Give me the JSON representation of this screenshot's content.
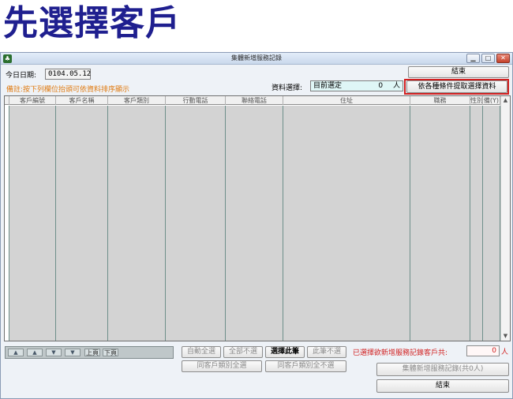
{
  "heading": "先選擇客戶",
  "window": {
    "title": "集體新增服務記錄",
    "app_icon": "app-icon",
    "controls": [
      "minimize",
      "maximize",
      "close"
    ]
  },
  "today": {
    "label": "今日日期:",
    "value": "0104.05.12"
  },
  "note": "備註:按下列欄位抬頭可依資料排序顯示",
  "selection": {
    "label": "資料選擇:",
    "value": "目前選定",
    "count": "0",
    "unit": "人"
  },
  "buttons": {
    "close_top": "結束",
    "filter": "依各種條件提取選擇資料",
    "auto_select_all": "自動全選",
    "deselect_all": "全部不選",
    "select_this": "選擇此筆",
    "deselect_this": "此筆不選",
    "same_type_select_all": "同客戶類別全選",
    "same_type_deselect_all": "同客戶類別全不選",
    "batch_add": "集體新增服務記錄(共0人)",
    "close_bottom": "結束"
  },
  "grid": {
    "columns": [
      "客戶編號",
      "客戶名稱",
      "客戶類別",
      "行動電話",
      "聯絡電話",
      "住址",
      "職務",
      "性別",
      "備(Y)"
    ]
  },
  "nav": {
    "prev_page": "上頁",
    "next_page": "下頁"
  },
  "selected_count": {
    "label": "已選擇欲新增服務記錄客戶共:",
    "value": "0",
    "unit": "人"
  }
}
